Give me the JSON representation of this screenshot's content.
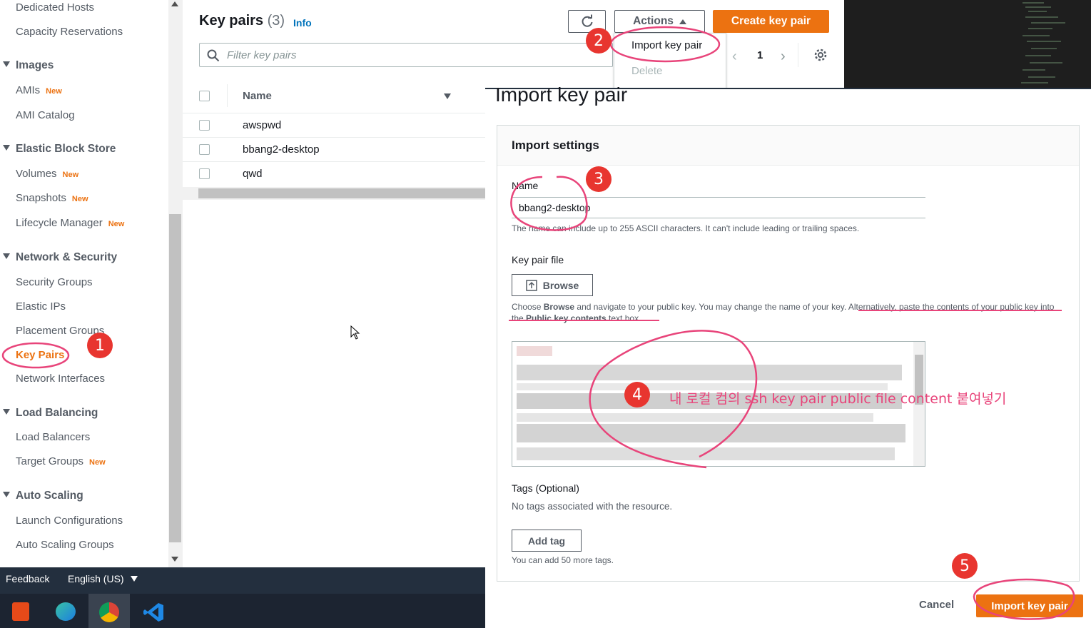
{
  "sidebar": {
    "items": [
      {
        "label": "Dedicated Hosts"
      },
      {
        "label": "Capacity Reservations"
      },
      {
        "section": "Images"
      },
      {
        "label": "AMIs",
        "badge": "New"
      },
      {
        "label": "AMI Catalog"
      },
      {
        "section": "Elastic Block Store"
      },
      {
        "label": "Volumes",
        "badge": "New"
      },
      {
        "label": "Snapshots",
        "badge": "New"
      },
      {
        "label": "Lifecycle Manager",
        "badge": "New"
      },
      {
        "section": "Network & Security"
      },
      {
        "label": "Security Groups"
      },
      {
        "label": "Elastic IPs"
      },
      {
        "label": "Placement Groups"
      },
      {
        "label": "Key Pairs",
        "active": true
      },
      {
        "label": "Network Interfaces"
      },
      {
        "section": "Load Balancing"
      },
      {
        "label": "Load Balancers"
      },
      {
        "label": "Target Groups",
        "badge": "New"
      },
      {
        "section": "Auto Scaling"
      },
      {
        "label": "Launch Configurations"
      },
      {
        "label": "Auto Scaling Groups"
      }
    ]
  },
  "keypairs": {
    "title": "Key pairs",
    "count": "(3)",
    "info": "Info",
    "actions_label": "Actions",
    "create_label": "Create key pair",
    "filter_placeholder": "Filter key pairs",
    "page_number": "1",
    "dropdown": {
      "import": "Import key pair",
      "delete": "Delete"
    },
    "column_name": "Name",
    "rows": [
      "awspwd",
      "bbang2-desktop",
      "qwd"
    ]
  },
  "dialog": {
    "title": "Import key pair",
    "section_title": "Import settings",
    "name_label": "Name",
    "name_value": "bbang2-desktop",
    "name_hint": "The name can include up to 255 ASCII characters. It can't include leading or trailing spaces.",
    "file_label": "Key pair file",
    "browse_label": "Browse",
    "file_hint_1": "Choose ",
    "file_hint_b1": "Browse",
    "file_hint_2": " and navigate to your public key. You may change the name of your key. Alternatively, paste the contents of your public key into the ",
    "file_hint_b2": "Public key contents",
    "file_hint_3": " text box.",
    "tags_label": "Tags (Optional)",
    "tags_empty": "No tags associated with the resource.",
    "add_tag_label": "Add tag",
    "tags_hint": "You can add 50 more tags.",
    "cancel_label": "Cancel",
    "import_label": "Import key pair"
  },
  "annotations": {
    "n1": "1",
    "n2": "2",
    "n3": "3",
    "n4": "4",
    "n5": "5",
    "note": "내 로컬 컴의 ssh key pair public file content 붙여넣기",
    "color": "#e8447a"
  },
  "footer": {
    "feedback": "Feedback",
    "language": "English (US)"
  },
  "colors": {
    "accent": "#ec7211",
    "nav_dark": "#232f3e",
    "link": "#0073bb"
  }
}
